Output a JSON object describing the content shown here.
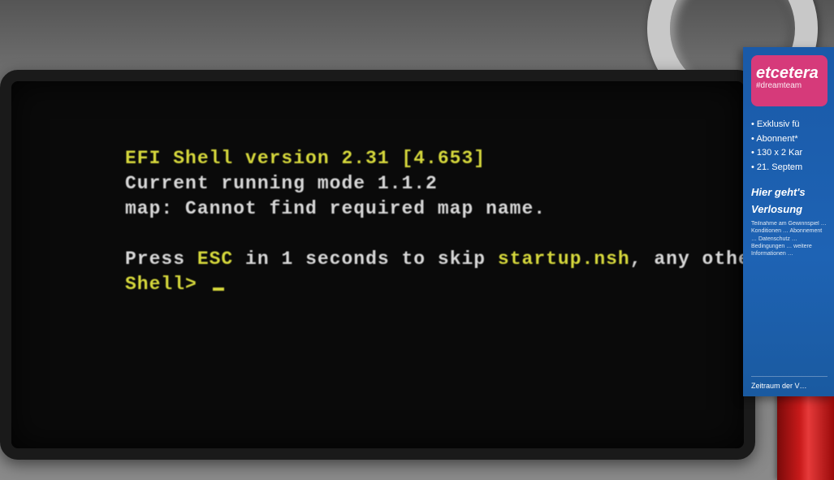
{
  "shell": {
    "header": "EFI Shell version 2.31 [4.653]",
    "mode": "Current running mode 1.1.2",
    "map": "map: Cannot find required map name.",
    "press_a": "Press ",
    "press_key": "ESC",
    "press_b": " in 1 seconds to skip ",
    "press_file": "startup.nsh",
    "press_c": ", any other key to",
    "prompt": "Shell> "
  },
  "advert": {
    "brand": "etcetera",
    "tag": "#dreamteam",
    "bullets": [
      "Exklusiv fü",
      "Abonnent*",
      "130 x 2 Kar",
      "21. Septem"
    ],
    "mid1": "Hier geht's",
    "mid2": "Verlosung",
    "fine": "Teilnahme am Gewinnspiel … Konditionen … Abonnement … Datenschutz … Bedingungen … weitere Informationen …",
    "foot": "Zeitraum der V…"
  }
}
